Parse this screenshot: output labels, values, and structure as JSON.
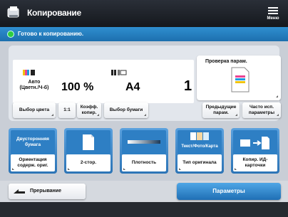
{
  "header": {
    "title": "Копирование",
    "menu_label": "Меню",
    "accent": "#1f2329"
  },
  "status": {
    "text": "Готово к копированию.",
    "color": "#2386cf"
  },
  "summary": {
    "color_mode": "Авто (Цветн./Ч-б)",
    "zoom": "100 %",
    "paper": "A4",
    "copies": "1"
  },
  "preview": {
    "label": "Проверка парам."
  },
  "settings_buttons": [
    {
      "label": "Выбор цвета"
    },
    {
      "label": "1:1"
    },
    {
      "label": "Коэфф. копир."
    },
    {
      "label": "Выбор бумаги"
    }
  ],
  "aux_buttons": [
    {
      "label": "Предыдущие парам."
    },
    {
      "label": "Часто исп. параметры"
    }
  ],
  "functions": [
    {
      "icon_text": "Двусторонняя бумага",
      "label": "Ориентация содерж. ориг.",
      "icon": "orientation-icon"
    },
    {
      "icon_text": "",
      "label": "2-стор.",
      "icon": "two-sided-icon"
    },
    {
      "icon_text": "",
      "label": "Плотность",
      "icon": "density-icon"
    },
    {
      "icon_text": "Текст/Фото/Карта",
      "label": "Тип оригинала",
      "icon": "original-type-icon"
    },
    {
      "icon_text": "",
      "label": "Копир. ИД-карточки",
      "icon": "id-card-icon"
    }
  ],
  "bottom": {
    "interrupt_label": "Прерывание",
    "options_label": "Параметры"
  }
}
